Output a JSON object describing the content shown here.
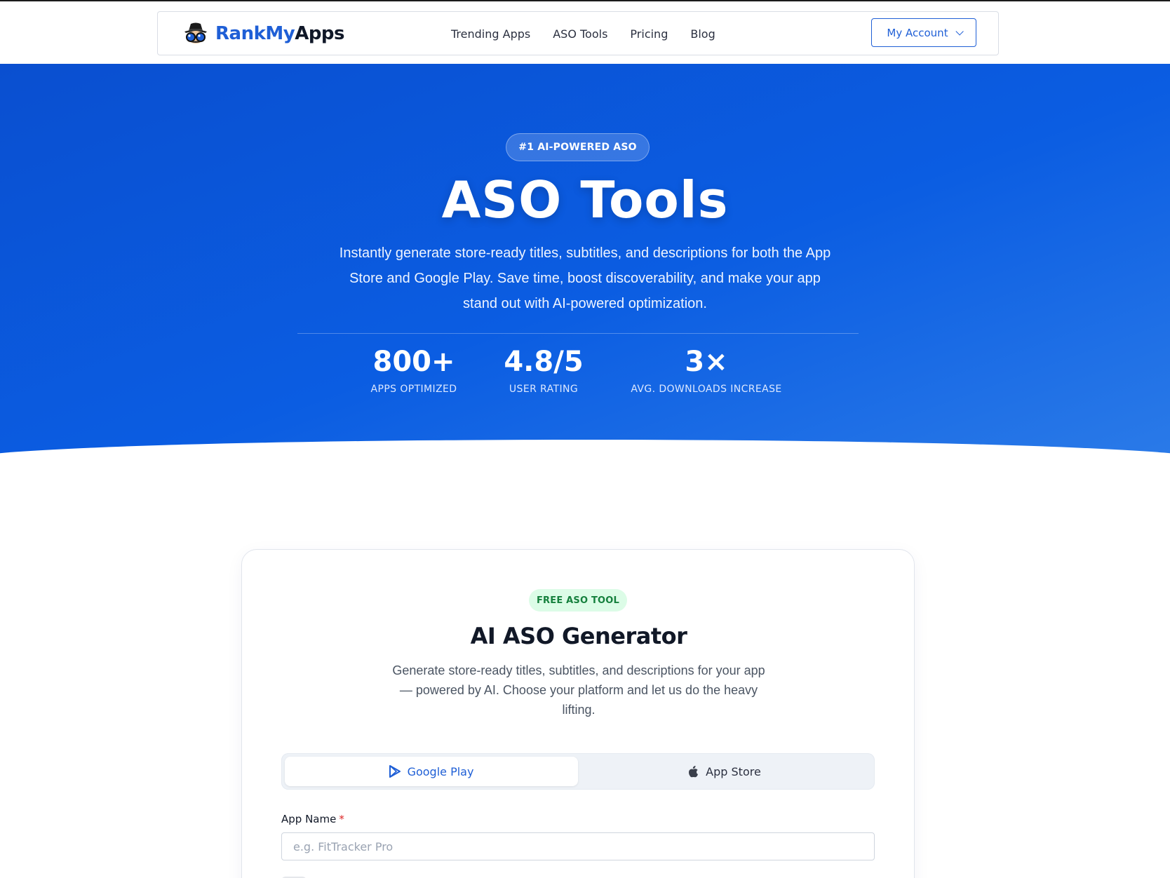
{
  "header": {
    "logo": {
      "rank": "Rank",
      "my": "My",
      "apps": "Apps"
    },
    "nav": [
      {
        "label": "Trending Apps"
      },
      {
        "label": "ASO Tools"
      },
      {
        "label": "Pricing"
      },
      {
        "label": "Blog"
      }
    ],
    "account_button": "My Account"
  },
  "hero": {
    "badge": "#1 AI-POWERED ASO",
    "title": "ASO Tools",
    "subtitle": "Instantly generate store-ready titles, subtitles, and descriptions for both the App Store and Google Play. Save time, boost discoverability, and make your app stand out with AI-powered optimization.",
    "stats": [
      {
        "value": "800+",
        "label": "APPS OPTIMIZED"
      },
      {
        "value": "4.8/5",
        "label": "USER RATING"
      },
      {
        "value": "3×",
        "label": "AVG. DOWNLOADS INCREASE"
      }
    ]
  },
  "generator": {
    "pill": "FREE ASO TOOL",
    "title": "AI ASO Generator",
    "subtitle": "Generate store-ready titles, subtitles, and descriptions for your app — powered by AI. Choose your platform and let us do the heavy lifting.",
    "tabs": [
      {
        "label": "Google Play",
        "icon": "google-play-icon",
        "active": true
      },
      {
        "label": "App Store",
        "icon": "apple-icon",
        "active": false
      }
    ],
    "app_name": {
      "label": "App Name",
      "required_mark": "*",
      "value": "",
      "placeholder": "e.g. FitTracker Pro"
    }
  },
  "colors": {
    "brand_blue": "#1f5fd6",
    "hero_start": "#0a4fd0",
    "hero_end": "#2a7ae8",
    "pill_bg": "#dcfce7",
    "pill_text": "#15803d",
    "required": "#dc2626"
  }
}
